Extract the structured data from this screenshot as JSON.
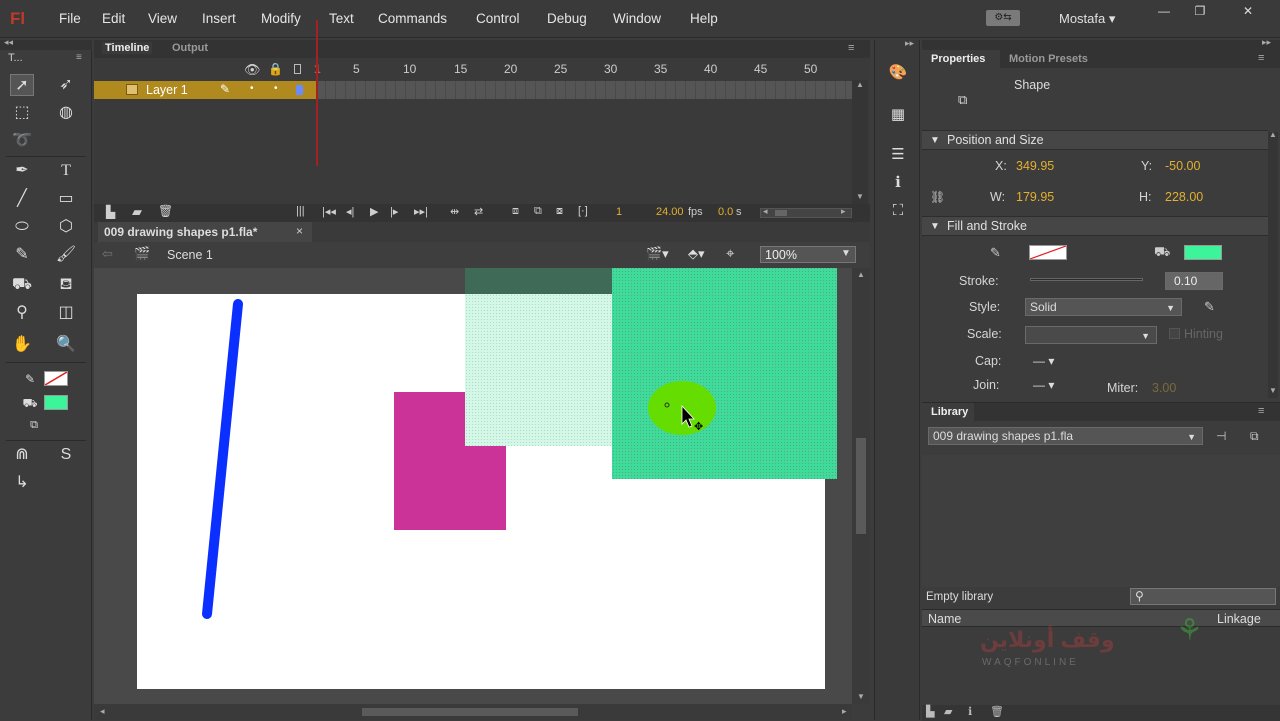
{
  "app": {
    "logo": "Fl",
    "user": "Mostafa"
  },
  "menu": [
    "File",
    "Edit",
    "View",
    "Insert",
    "Modify",
    "Text",
    "Commands",
    "Control",
    "Debug",
    "Window",
    "Help"
  ],
  "tools_header": "T...",
  "timeline": {
    "tabs": [
      "Timeline",
      "Output"
    ],
    "ruler": [
      "1",
      "5",
      "10",
      "15",
      "20",
      "25",
      "30",
      "35",
      "40",
      "45",
      "50"
    ],
    "layer_name": "Layer 1",
    "current_frame": "1",
    "fps": "24.00",
    "fps_unit": "fps",
    "time": "0.0",
    "time_unit": "s"
  },
  "document": {
    "tab_title": "009 drawing shapes p1.fla*",
    "close": "×",
    "scene": "Scene 1",
    "zoom": "100%"
  },
  "properties": {
    "tabs": [
      "Properties",
      "Motion Presets"
    ],
    "object_type": "Shape",
    "position_size": {
      "header": "Position and Size",
      "x_label": "X:",
      "x": "349.95",
      "y_label": "Y:",
      "y": "-50.00",
      "w_label": "W:",
      "w": "179.95",
      "h_label": "H:",
      "h": "228.00"
    },
    "fill_stroke": {
      "header": "Fill and Stroke",
      "stroke_label": "Stroke:",
      "stroke": "0.10",
      "style_label": "Style:",
      "style": "Solid",
      "scale_label": "Scale:",
      "hinting": "Hinting",
      "cap_label": "Cap:",
      "join_label": "Join:",
      "miter_label": "Miter:",
      "miter": "3.00",
      "fill_color": "#3cf59b"
    }
  },
  "library": {
    "header": "Library",
    "file": "009 drawing shapes p1.fla",
    "empty": "Empty library",
    "col_name": "Name",
    "col_linkage": "Linkage"
  },
  "watermark": {
    "arabic": "وقف أونلاين",
    "latin": "WAQFONLINE"
  },
  "colors": {
    "accent": "#b08a1e",
    "value": "#e3b02f",
    "blue_line": "#0a2fff",
    "magenta_rect": "#cc3399",
    "green_rect": "#3ddc9a",
    "light_green_rect": "#c8f5e2",
    "lime_circle": "#66dd00"
  }
}
